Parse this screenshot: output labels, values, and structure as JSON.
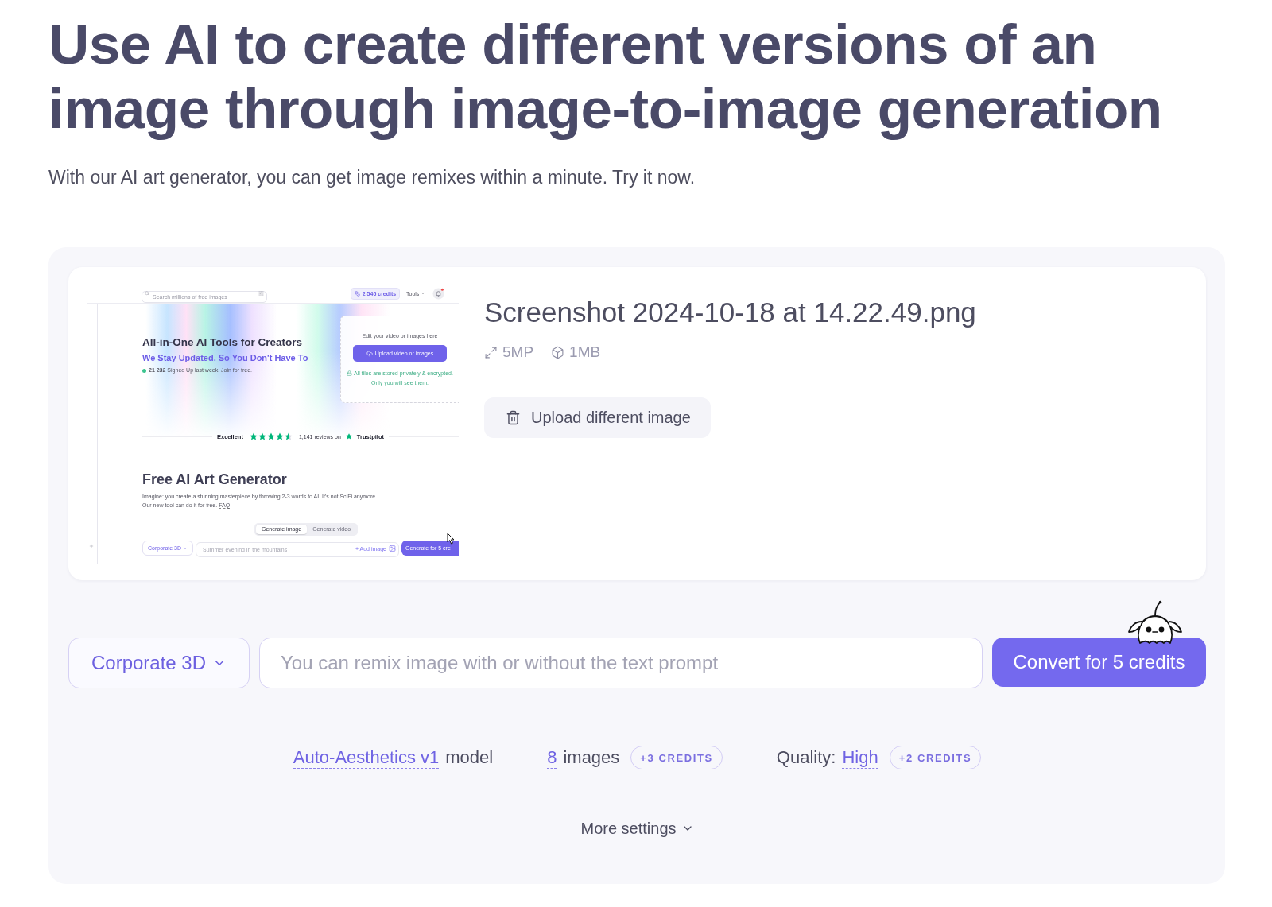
{
  "hero": {
    "title": "Use AI to create different versions of an image through image-to-image generation",
    "subtitle": "With our AI art generator, you can get image remixes within a minute. Try it now."
  },
  "upload_card": {
    "preview": {
      "search": {
        "placeholder": "Search millions of free images"
      },
      "credits": "2 546 credits",
      "menu": "Tools",
      "hero_title": "All-in-One AI Tools for Creators",
      "hero_tagline": "We Stay Updated, So You Don't Have To",
      "signups": "**21 232** Signed Up last week. Join for free.",
      "upload_caption": "Edit your video or images here",
      "upload_button": "Upload video or images",
      "privacy_note": "All files are stored privately & encrypted. Only you will see them.",
      "rating": {
        "label": "Excellent",
        "stars": 4.5,
        "reviews": "1,141 reviews on",
        "brand": "Trustpilot"
      },
      "section_title": "Free AI Art Generator",
      "description": "Imagine: you create a stunning masterpiece by throwing 2-3 words to AI. It's not SciFi anymore.\nOur new tool can do it for free.",
      "faq_link": "FAQ",
      "tabs": [
        {
          "label": "Generate image",
          "selected": true
        },
        {
          "label": "Generate video",
          "selected": false
        }
      ],
      "style": "Corporate 3D",
      "prompt": {
        "placeholder": "Summer evening in the mountains"
      },
      "add_image": "+ Add image",
      "generate_button": "Generate for 5 cre"
    },
    "file_name": "Screenshot 2024-10-18 at 14.22.49.png",
    "meta": [
      {
        "kind": "resolution",
        "text": "5MP"
      },
      {
        "kind": "file_size",
        "text": "1MB"
      }
    ],
    "upload_button": "Upload different image"
  },
  "controls": {
    "style_dropdown": "Corporate 3D",
    "prompt": {
      "placeholder": "You can remix image with or without the text prompt"
    },
    "convert_button": "Convert for 5 credits"
  },
  "settings": [
    {
      "value": "Auto-Aesthetics v1",
      "suffix": "model"
    },
    {
      "value": "8",
      "suffix": "images",
      "badge": "+3 CREDITS"
    },
    {
      "prefix": "Quality:",
      "value": "High",
      "badge": "+2 CREDITS"
    }
  ],
  "more_settings": "More settings"
}
